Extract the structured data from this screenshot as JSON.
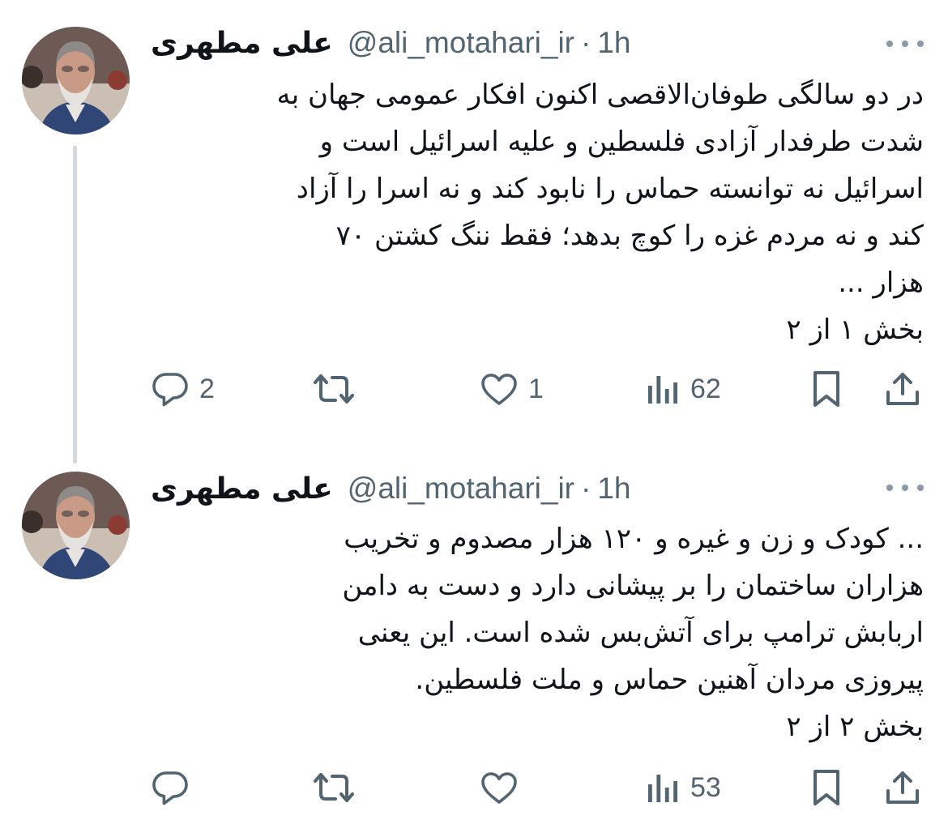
{
  "tweets": [
    {
      "author_name": "علی مطهری",
      "handle": "@ali_motahari_ir",
      "dot": "·",
      "time": "1h",
      "lines": [
        "در دو سالگی طوفان‌الاقصی اکنون افکار عمومی جهان به",
        "شدت طرفدار آزادی فلسطین و علیه اسرائیل است و",
        "اسرائیل نه توانسته حماس را نابود کند و نه اسرا را آزاد",
        "کند و نه مردم غزه را کوچ بدهد؛ فقط ننگ کشتن ۷۰",
        "هزار ...",
        "بخش ۱ از ۲"
      ],
      "replies": "2",
      "retweets": "",
      "likes": "1",
      "views": "62"
    },
    {
      "author_name": "علی مطهری",
      "handle": "@ali_motahari_ir",
      "dot": "·",
      "time": "1h",
      "lines": [
        "... کودک و زن و غیره و ۱۲۰ هزار مصدوم و تخریب",
        "هزاران ساختمان را بر پیشانی دارد و دست به دامن",
        "اربابش ترامپ برای آتش‌بس شده است. این یعنی",
        "پیروزی مردان آهنین حماس و ملت فلسطین.",
        "بخش ۲ از ۲"
      ],
      "replies": "",
      "retweets": "",
      "likes": "",
      "views": "53"
    }
  ],
  "icons": {
    "reply": "reply-icon",
    "retweet": "retweet-icon",
    "like": "heart-icon",
    "views": "views-icon",
    "bookmark": "bookmark-icon",
    "share": "share-icon",
    "more": "more-icon"
  },
  "colors": {
    "text": "#0f1419",
    "secondary": "#536471",
    "thread_line": "#cfd9de"
  }
}
